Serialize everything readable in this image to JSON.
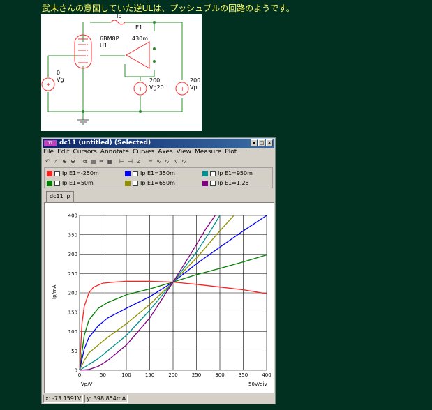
{
  "caption": "武末さんの意図していた逆ULは、プッシュプルの回路のようです。",
  "schematic": {
    "tube_type": "6BM8P",
    "tube_ref": "U1",
    "ip_label": "Ip",
    "e1_label": "E1",
    "e1_gain": "430m",
    "vg_value": "0",
    "vg_label": "Vg",
    "vg20_value": "200",
    "vg20_label": "Vg20",
    "vp_value": "200",
    "vp_label": "Vp"
  },
  "window": {
    "app_icon": "Tl",
    "title": "dc11 (untitled) (Selected)",
    "menu": [
      "File",
      "Edit",
      "Cursors",
      "Annotate",
      "Curves",
      "Axes",
      "View",
      "Measure",
      "Plot"
    ],
    "tab": "dc11 Ip",
    "status_x": "x: -73.1591V",
    "status_y": "y: 398.854mA"
  },
  "legend": [
    {
      "label": "Ip E1=-250m",
      "color": "#ff2020"
    },
    {
      "label": "Ip E1=350m",
      "color": "#0000ff"
    },
    {
      "label": "Ip E1=950m",
      "color": "#009090"
    },
    {
      "label": "Ip E1=50m",
      "color": "#008000"
    },
    {
      "label": "Ip E1=650m",
      "color": "#909000"
    },
    {
      "label": "Ip E1=1.25",
      "color": "#800080"
    }
  ],
  "chart_data": {
    "type": "line",
    "xlabel": "Vp/V",
    "ylabel": "Ip/mA",
    "x_div_label": "50V/div",
    "xlim": [
      0,
      400
    ],
    "ylim": [
      0,
      400
    ],
    "xticks": [
      0,
      50,
      100,
      150,
      200,
      250,
      300,
      350,
      400
    ],
    "yticks": [
      0,
      50,
      100,
      150,
      200,
      250,
      300,
      350,
      400
    ],
    "grid": true,
    "series": [
      {
        "name": "Ip E1=-250m",
        "color": "#ff2020",
        "x": [
          0,
          5,
          10,
          20,
          30,
          50,
          75,
          100,
          150,
          200,
          250,
          300,
          350,
          400
        ],
        "y": [
          0,
          120,
          165,
          200,
          215,
          225,
          228,
          230,
          230,
          228,
          222,
          215,
          208,
          198
        ]
      },
      {
        "name": "Ip E1=50m",
        "color": "#008000",
        "x": [
          0,
          10,
          20,
          40,
          60,
          100,
          150,
          200,
          250,
          300,
          350,
          400
        ],
        "y": [
          0,
          90,
          130,
          160,
          175,
          195,
          210,
          228,
          247,
          263,
          280,
          298
        ]
      },
      {
        "name": "Ip E1=350m",
        "color": "#0000ff",
        "x": [
          0,
          10,
          20,
          40,
          60,
          100,
          150,
          200,
          250,
          300,
          350,
          400
        ],
        "y": [
          0,
          55,
          85,
          115,
          135,
          160,
          190,
          228,
          275,
          318,
          360,
          400
        ]
      },
      {
        "name": "Ip E1=650m",
        "color": "#909000",
        "x": [
          0,
          10,
          20,
          40,
          60,
          100,
          150,
          200,
          250,
          300,
          330
        ],
        "y": [
          0,
          25,
          45,
          65,
          85,
          120,
          170,
          228,
          290,
          360,
          400
        ]
      },
      {
        "name": "Ip E1=950m",
        "color": "#009090",
        "x": [
          0,
          20,
          40,
          60,
          100,
          150,
          200,
          250,
          280,
          300
        ],
        "y": [
          0,
          15,
          30,
          50,
          90,
          155,
          228,
          305,
          360,
          400
        ]
      },
      {
        "name": "Ip E1=1.25",
        "color": "#800080",
        "x": [
          0,
          20,
          40,
          60,
          100,
          150,
          200,
          240,
          270,
          290
        ],
        "y": [
          0,
          2,
          10,
          25,
          65,
          135,
          228,
          305,
          365,
          400
        ]
      }
    ]
  }
}
